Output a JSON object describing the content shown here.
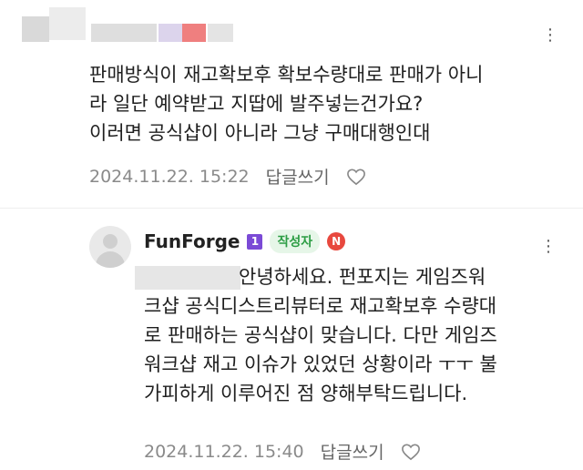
{
  "comment": {
    "lines": [
      "판매방식이 재고확보후 확보수량대로 판매가 아니",
      "라 일단 예약받고 지땁에 발주넣는건가요?",
      "이러면 공식샵이 아니라 그냥 구매대행인대"
    ],
    "timestamp": "2024.11.22. 15:22",
    "reply_label": "답글쓰기",
    "more_icon": "⋮"
  },
  "reply": {
    "author": "FunForge",
    "level_badge": "1",
    "author_badge": "작성자",
    "new_badge": "N",
    "lines": [
      "안녕하세요. 펀포지는 게임즈워",
      "크샵 공식디스트리뷰터로 재고확보후 수량대",
      "로 판매하는 공식샵이 맞습니다. 다만 게임즈",
      "워크샵 재고 이슈가 있었던 상황이라 ㅜㅜ 불",
      "가피하게 이루어진 점 양해부탁드립니다."
    ],
    "timestamp": "2024.11.22. 15:40",
    "reply_label": "답글쓰기",
    "more_icon": "⋮"
  },
  "colors": {
    "text": "#1f1f1f",
    "meta": "#8a8a8a",
    "author_badge_bg": "#e6f6e8",
    "author_badge_text": "#2c9d44",
    "level_badge": "#7b4ad6",
    "new_badge": "#e8483e"
  },
  "icons": {
    "heart": "heart-icon",
    "more": "more-vertical-icon",
    "avatar": "default-avatar-icon"
  }
}
